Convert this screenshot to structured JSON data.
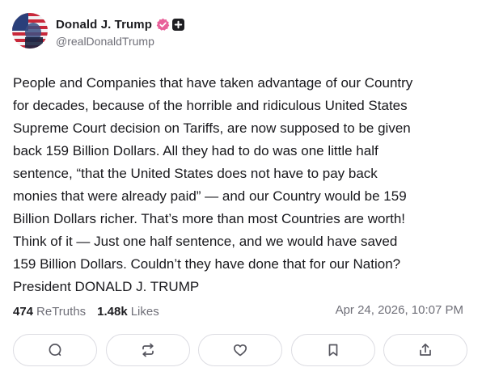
{
  "author": {
    "display_name": "Donald J. Trump",
    "handle": "@realDonaldTrump",
    "verified_icon": "verified-check-icon",
    "badge_icon": "plus-badge-icon",
    "verified_color": "#e8619a"
  },
  "post": {
    "lines": [
      "People and Companies that have taken advantage of our Country",
      "for decades, because of the horrible and ridiculous United States",
      "Supreme Court decision on Tariffs, are now supposed to be given",
      "back 159 Billion Dollars. All they had to do was one little half",
      "sentence, “that the United States does not have to pay back",
      "monies that were already paid” — and our Country would be 159",
      "Billion Dollars richer. That’s more than most Countries are worth!",
      "Think of it — Just one half sentence, and we would have saved",
      "159 Billion Dollars. Couldn’t they have done that for our Nation?",
      "President DONALD J. TRUMP"
    ]
  },
  "stats": {
    "retruths_count": "474",
    "retruths_label": "ReTruths",
    "likes_count": "1.48k",
    "likes_label": "Likes",
    "timestamp": "Apr 24, 2026, 10:07 PM"
  },
  "actions": [
    {
      "name": "reply-button",
      "icon": "comment-icon"
    },
    {
      "name": "retruth-button",
      "icon": "retruth-icon"
    },
    {
      "name": "like-button",
      "icon": "heart-icon"
    },
    {
      "name": "bookmark-button",
      "icon": "bookmark-icon"
    },
    {
      "name": "share-button",
      "icon": "share-icon"
    }
  ],
  "colors": {
    "text": "#18181c",
    "muted": "#6f6f78",
    "border": "#dcdce2",
    "icon": "#55555e"
  }
}
